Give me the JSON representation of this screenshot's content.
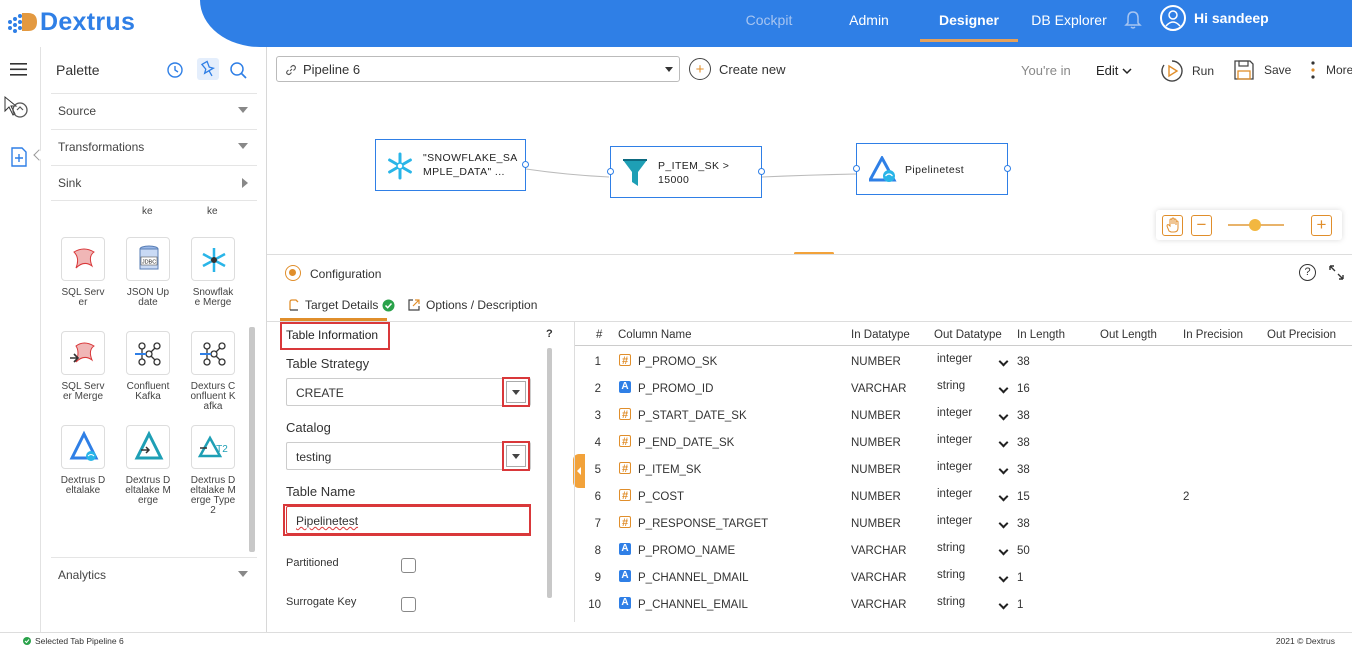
{
  "app": {
    "logo": "Dextrus"
  },
  "nav": {
    "cockpit": "Cockpit",
    "admin": "Admin",
    "designer": "Designer",
    "db_explorer": "DB Explorer",
    "user": "Hi sandeep"
  },
  "palette": {
    "title": "Palette",
    "sections": {
      "source": "Source",
      "transformations": "Transformations",
      "sink": "Sink",
      "analytics": "Analytics"
    },
    "partial_labels": [
      "ke",
      "ke"
    ],
    "tiles": [
      {
        "label": "SQL Server",
        "icon": "sql-server-icon"
      },
      {
        "label": "JSON Update",
        "icon": "jdbc-icon"
      },
      {
        "label": "Snowflake Merge",
        "icon": "snowflake-merge-icon"
      },
      {
        "label": "SQL Server Merge",
        "icon": "sql-server-merge-icon"
      },
      {
        "label": "Confluent Kafka",
        "icon": "kafka-icon"
      },
      {
        "label": "Dexturs Confluent Kafka",
        "icon": "kafka-icon"
      },
      {
        "label": "Dextrus Deltalake",
        "icon": "deltalake-icon"
      },
      {
        "label": "Dextrus Deltalake Merge",
        "icon": "deltalake-merge-icon"
      },
      {
        "label": "Dextrus Deltalake Merge Type 2",
        "icon": "deltalake-merge2-icon"
      }
    ]
  },
  "toolbar": {
    "pipeline": "Pipeline 6",
    "create_new": "Create new",
    "youre_in": "You're in",
    "mode": "Edit",
    "run": "Run",
    "save": "Save",
    "more": "More"
  },
  "canvas": {
    "nodes": [
      {
        "label": "\"SNOWFLAKE_SAMPLE_DATA\" ..."
      },
      {
        "label": "P_ITEM_SK > 15000"
      },
      {
        "label": "Pipelinetest"
      }
    ]
  },
  "config": {
    "title": "Configuration",
    "tab_target": "Target Details",
    "tab_options": "Options / Description",
    "help": "?"
  },
  "form": {
    "section_title": "Table Information",
    "help": "?",
    "strategy_label": "Table Strategy",
    "strategy_value": "CREATE",
    "catalog_label": "Catalog",
    "catalog_value": "testing",
    "table_name_label": "Table Name",
    "table_name_value": "Pipelinetest",
    "partitioned": "Partitioned",
    "surrogate": "Surrogate Key"
  },
  "grid": {
    "headers": [
      "#",
      "Column Name",
      "In Datatype",
      "Out Datatype",
      "In Length",
      "Out Length",
      "In Precision",
      "Out Precision"
    ],
    "rows": [
      {
        "n": "1",
        "type": "num",
        "name": "P_PROMO_SK",
        "in": "NUMBER",
        "out": "integer",
        "len": "38",
        "prec": ""
      },
      {
        "n": "2",
        "type": "str",
        "name": "P_PROMO_ID",
        "in": "VARCHAR",
        "out": "string",
        "len": "16",
        "prec": ""
      },
      {
        "n": "3",
        "type": "num",
        "name": "P_START_DATE_SK",
        "in": "NUMBER",
        "out": "integer",
        "len": "38",
        "prec": ""
      },
      {
        "n": "4",
        "type": "num",
        "name": "P_END_DATE_SK",
        "in": "NUMBER",
        "out": "integer",
        "len": "38",
        "prec": ""
      },
      {
        "n": "5",
        "type": "num",
        "name": "P_ITEM_SK",
        "in": "NUMBER",
        "out": "integer",
        "len": "38",
        "prec": ""
      },
      {
        "n": "6",
        "type": "num",
        "name": "P_COST",
        "in": "NUMBER",
        "out": "integer",
        "len": "15",
        "prec": "2"
      },
      {
        "n": "7",
        "type": "num",
        "name": "P_RESPONSE_TARGET",
        "in": "NUMBER",
        "out": "integer",
        "len": "38",
        "prec": ""
      },
      {
        "n": "8",
        "type": "str",
        "name": "P_PROMO_NAME",
        "in": "VARCHAR",
        "out": "string",
        "len": "50",
        "prec": ""
      },
      {
        "n": "9",
        "type": "str",
        "name": "P_CHANNEL_DMAIL",
        "in": "VARCHAR",
        "out": "string",
        "len": "1",
        "prec": ""
      },
      {
        "n": "10",
        "type": "str",
        "name": "P_CHANNEL_EMAIL",
        "in": "VARCHAR",
        "out": "string",
        "len": "1",
        "prec": ""
      }
    ]
  },
  "status": {
    "left": "Selected Tab Pipeline 6",
    "right": "2021 © Dextrus"
  },
  "colors": {
    "brand": "#2f7fe6",
    "accent": "#e08e2b",
    "highlight": "#d9383a",
    "ok": "#2aa24a"
  }
}
